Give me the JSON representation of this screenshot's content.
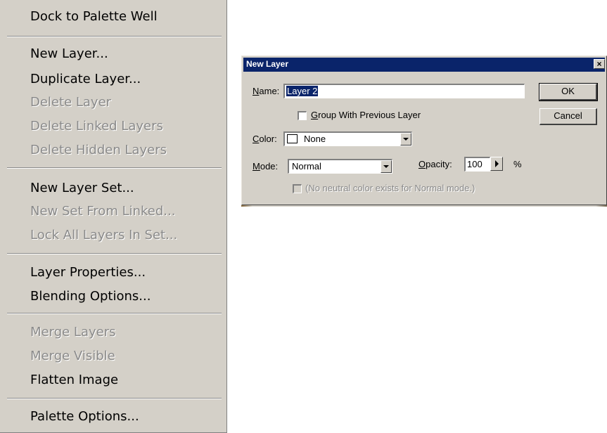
{
  "menu": {
    "items": [
      {
        "label": "Dock to Palette Well",
        "enabled": true
      },
      {
        "label": "New Layer...",
        "enabled": true
      },
      {
        "label": "Duplicate Layer...",
        "enabled": true
      },
      {
        "label": "Delete Layer",
        "enabled": false
      },
      {
        "label": "Delete Linked Layers",
        "enabled": false
      },
      {
        "label": "Delete Hidden Layers",
        "enabled": false
      },
      {
        "label": "New Layer Set...",
        "enabled": true
      },
      {
        "label": "New Set From Linked...",
        "enabled": false
      },
      {
        "label": "Lock All Layers In Set...",
        "enabled": false
      },
      {
        "label": "Layer Properties...",
        "enabled": true
      },
      {
        "label": "Blending Options...",
        "enabled": true
      },
      {
        "label": "Merge Layers",
        "enabled": false
      },
      {
        "label": "Merge Visible",
        "enabled": false
      },
      {
        "label": "Flatten Image",
        "enabled": true
      },
      {
        "label": "Palette Options...",
        "enabled": true
      }
    ]
  },
  "dialog": {
    "title": "New Layer",
    "close_glyph": "×",
    "name": {
      "label_u": "N",
      "label_rest": "ame:",
      "value": "Layer 2"
    },
    "group": {
      "label_u": "G",
      "label_rest": "roup With Previous Layer",
      "checked": false
    },
    "color": {
      "label_u": "C",
      "label_rest": "olor:",
      "value": "None"
    },
    "mode": {
      "label_u": "M",
      "label_rest": "ode:",
      "value": "Normal"
    },
    "opacity": {
      "label_u": "O",
      "label_rest": "pacity:",
      "value": "100",
      "unit": "%"
    },
    "neutral": {
      "label": "(No neutral color exists for Normal mode.)",
      "enabled": false
    },
    "ok_label": "OK",
    "cancel_label": "Cancel"
  }
}
